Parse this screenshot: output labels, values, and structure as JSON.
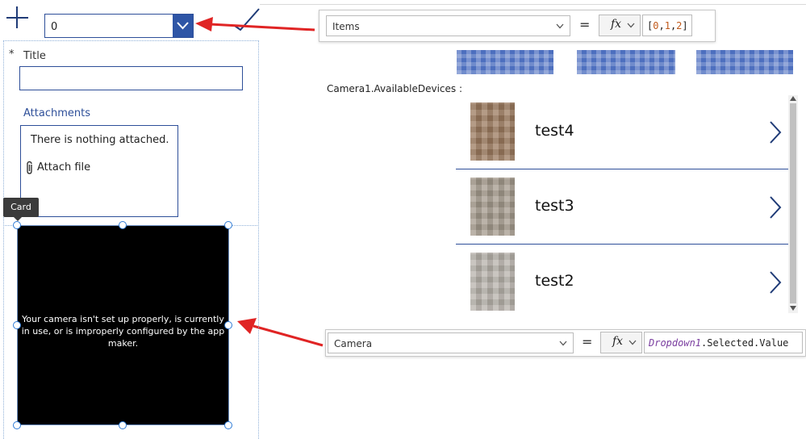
{
  "toolbar": {
    "add_icon": "plus-icon",
    "dropdown_value": "0",
    "check_icon": "checkmark-icon"
  },
  "form": {
    "required_marker": "*",
    "title_label": "Title",
    "title_value": "",
    "attachments_label": "Attachments",
    "attachments_empty": "There is nothing attached.",
    "attach_file_label": "Attach file"
  },
  "card_tooltip": "Card",
  "camera": {
    "message": "Your camera isn't set up properly, is currently in use, or is improperly configured by the app maker."
  },
  "formula_bar_items": {
    "property": "Items",
    "equals": "=",
    "fx": "fx",
    "formula_open": "[",
    "v0": "0",
    "c1": ",",
    "v1": "1",
    "c2": ",",
    "v2": "2",
    "formula_close": "]"
  },
  "formula_bar_camera": {
    "property": "Camera",
    "equals": "=",
    "fx": "fx",
    "formula_ident": "Dropdown1",
    "formula_rest": ".Selected.Value"
  },
  "gallery": {
    "label": "Camera1.AvailableDevices :",
    "items": [
      {
        "label": "test4",
        "thumb_color": "#9b7a5e"
      },
      {
        "label": "test3",
        "thumb_color": "#a49a8c"
      },
      {
        "label": "test2",
        "thumb_color": "#b7b2ab"
      }
    ]
  },
  "colors": {
    "accent": "#2e4f99",
    "dropdown_button": "#2e55a6",
    "annotation_arrow": "#e02424",
    "camera_background": "#000000"
  }
}
